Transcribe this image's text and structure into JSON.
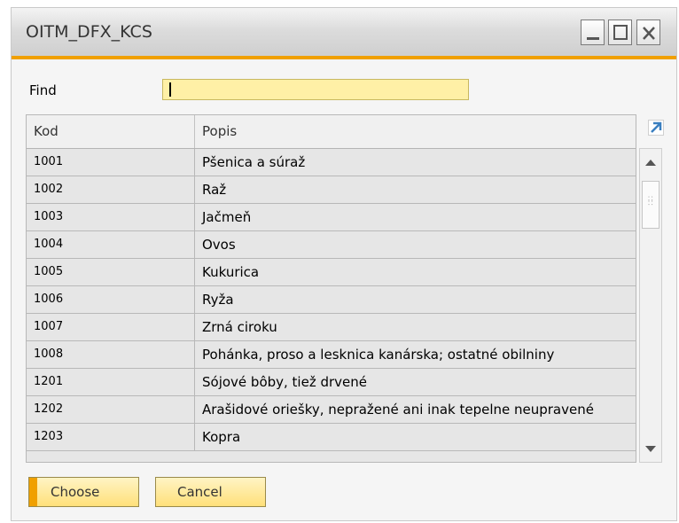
{
  "window": {
    "title": "OITM_DFX_KCS"
  },
  "find": {
    "label": "Find",
    "value": ""
  },
  "grid": {
    "columns": {
      "kod": "Kod",
      "popis": "Popis"
    },
    "rows": [
      {
        "kod": "1001",
        "popis": "Pšenica a súraž"
      },
      {
        "kod": "1002",
        "popis": "Raž"
      },
      {
        "kod": "1003",
        "popis": "Jačmeň"
      },
      {
        "kod": "1004",
        "popis": "Ovos"
      },
      {
        "kod": "1005",
        "popis": "Kukurica"
      },
      {
        "kod": "1006",
        "popis": "Ryža"
      },
      {
        "kod": "1007",
        "popis": "Zrná ciroku"
      },
      {
        "kod": "1008",
        "popis": "Pohánka, proso a lesknica kanárska; ostatné obilniny"
      },
      {
        "kod": "1201",
        "popis": "Sójové bôby, tiež drvené"
      },
      {
        "kod": "1202",
        "popis": "Arašidové oriešky, nepražené ani inak tepelne neupravené"
      },
      {
        "kod": "1203",
        "popis": "Kopra"
      }
    ]
  },
  "buttons": {
    "choose": "Choose",
    "cancel": "Cancel"
  },
  "colors": {
    "accent": "#f0a000",
    "find_bg": "#fff0a6",
    "row_bg": "#e6e6e6",
    "button_bg": "#ffe07a"
  }
}
